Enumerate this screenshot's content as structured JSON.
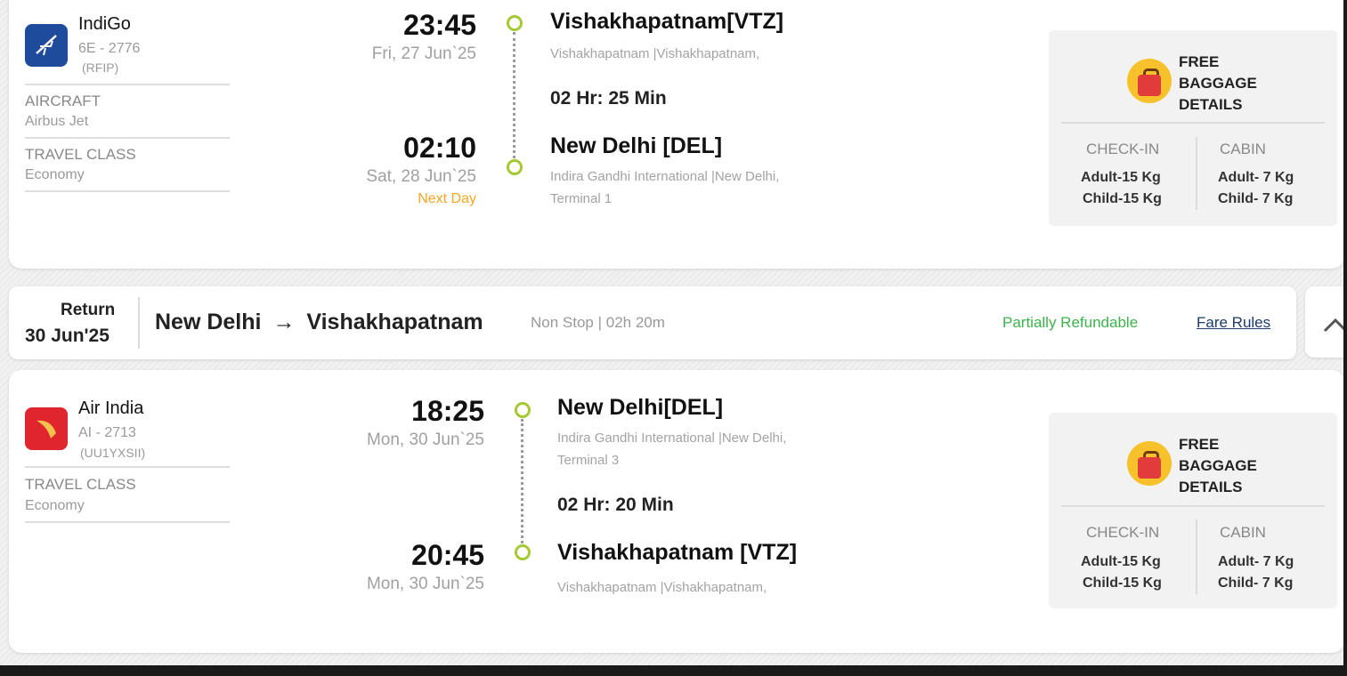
{
  "outbound": {
    "airline": "IndiGo",
    "flight_no": "6E - 2776",
    "fare_code": "(RFIP)",
    "aircraft_label": "AIRCRAFT",
    "aircraft_value": "Airbus Jet",
    "class_label": "TRAVEL CLASS",
    "class_value": "Economy",
    "dep_time": "23:45",
    "dep_date": "Fri, 27 Jun`25",
    "dep_city": "Vishakhapatnam[VTZ]",
    "dep_airport": "Vishakhapatnam |Vishakhapatnam,",
    "duration": "02 Hr: 25 Min",
    "arr_time": "02:10",
    "arr_date": "Sat, 28 Jun`25",
    "next_day": "Next Day",
    "arr_city": "New Delhi [DEL]",
    "arr_airport_line1": "Indira Gandhi International |New Delhi,",
    "arr_airport_line2": "Terminal 1",
    "baggage": {
      "title_line1": "FREE",
      "title_line2": "BAGGAGE",
      "title_line3": "DETAILS",
      "checkin_label": "CHECK-IN",
      "cabin_label": "CABIN",
      "checkin_adult": "Adult-15 Kg",
      "checkin_child": "Child-15 Kg",
      "cabin_adult": "Adult- 7 Kg",
      "cabin_child": "Child- 7 Kg"
    }
  },
  "return_bar": {
    "label": "Return",
    "date": "30 Jun'25",
    "route_from": "New Delhi",
    "route_arrow": "→",
    "route_to": "Vishakhapatnam",
    "stops": "Non Stop | 02h 20m",
    "refund_status": "Partially Refundable",
    "fare_rules": "Fare Rules",
    "refund_color": "#3cb34a"
  },
  "inbound": {
    "airline": "Air India",
    "flight_no": "AI - 2713",
    "fare_code": "(UU1YXSII)",
    "class_label": "TRAVEL CLASS",
    "class_value": "Economy",
    "dep_time": "18:25",
    "dep_date": "Mon, 30 Jun`25",
    "dep_city": "New Delhi[DEL]",
    "dep_airport_line1": "Indira Gandhi International |New Delhi,",
    "dep_airport_line2": "Terminal 3",
    "duration": "02 Hr: 20 Min",
    "arr_time": "20:45",
    "arr_date": "Mon, 30 Jun`25",
    "arr_city": "Vishakhapatnam [VTZ]",
    "arr_airport": "Vishakhapatnam |Vishakhapatnam,",
    "baggage": {
      "title_line1": "FREE",
      "title_line2": "BAGGAGE",
      "title_line3": "DETAILS",
      "checkin_label": "CHECK-IN",
      "cabin_label": "CABIN",
      "checkin_adult": "Adult-15 Kg",
      "checkin_child": "Child-15 Kg",
      "cabin_adult": "Adult- 7 Kg",
      "cabin_child": "Child- 7 Kg"
    }
  },
  "icons": {
    "indigo_logo": "indigo-logo-icon",
    "airindia_logo": "air-india-logo-icon",
    "baggage": "baggage-icon",
    "collapse": "chevron-up-icon"
  }
}
